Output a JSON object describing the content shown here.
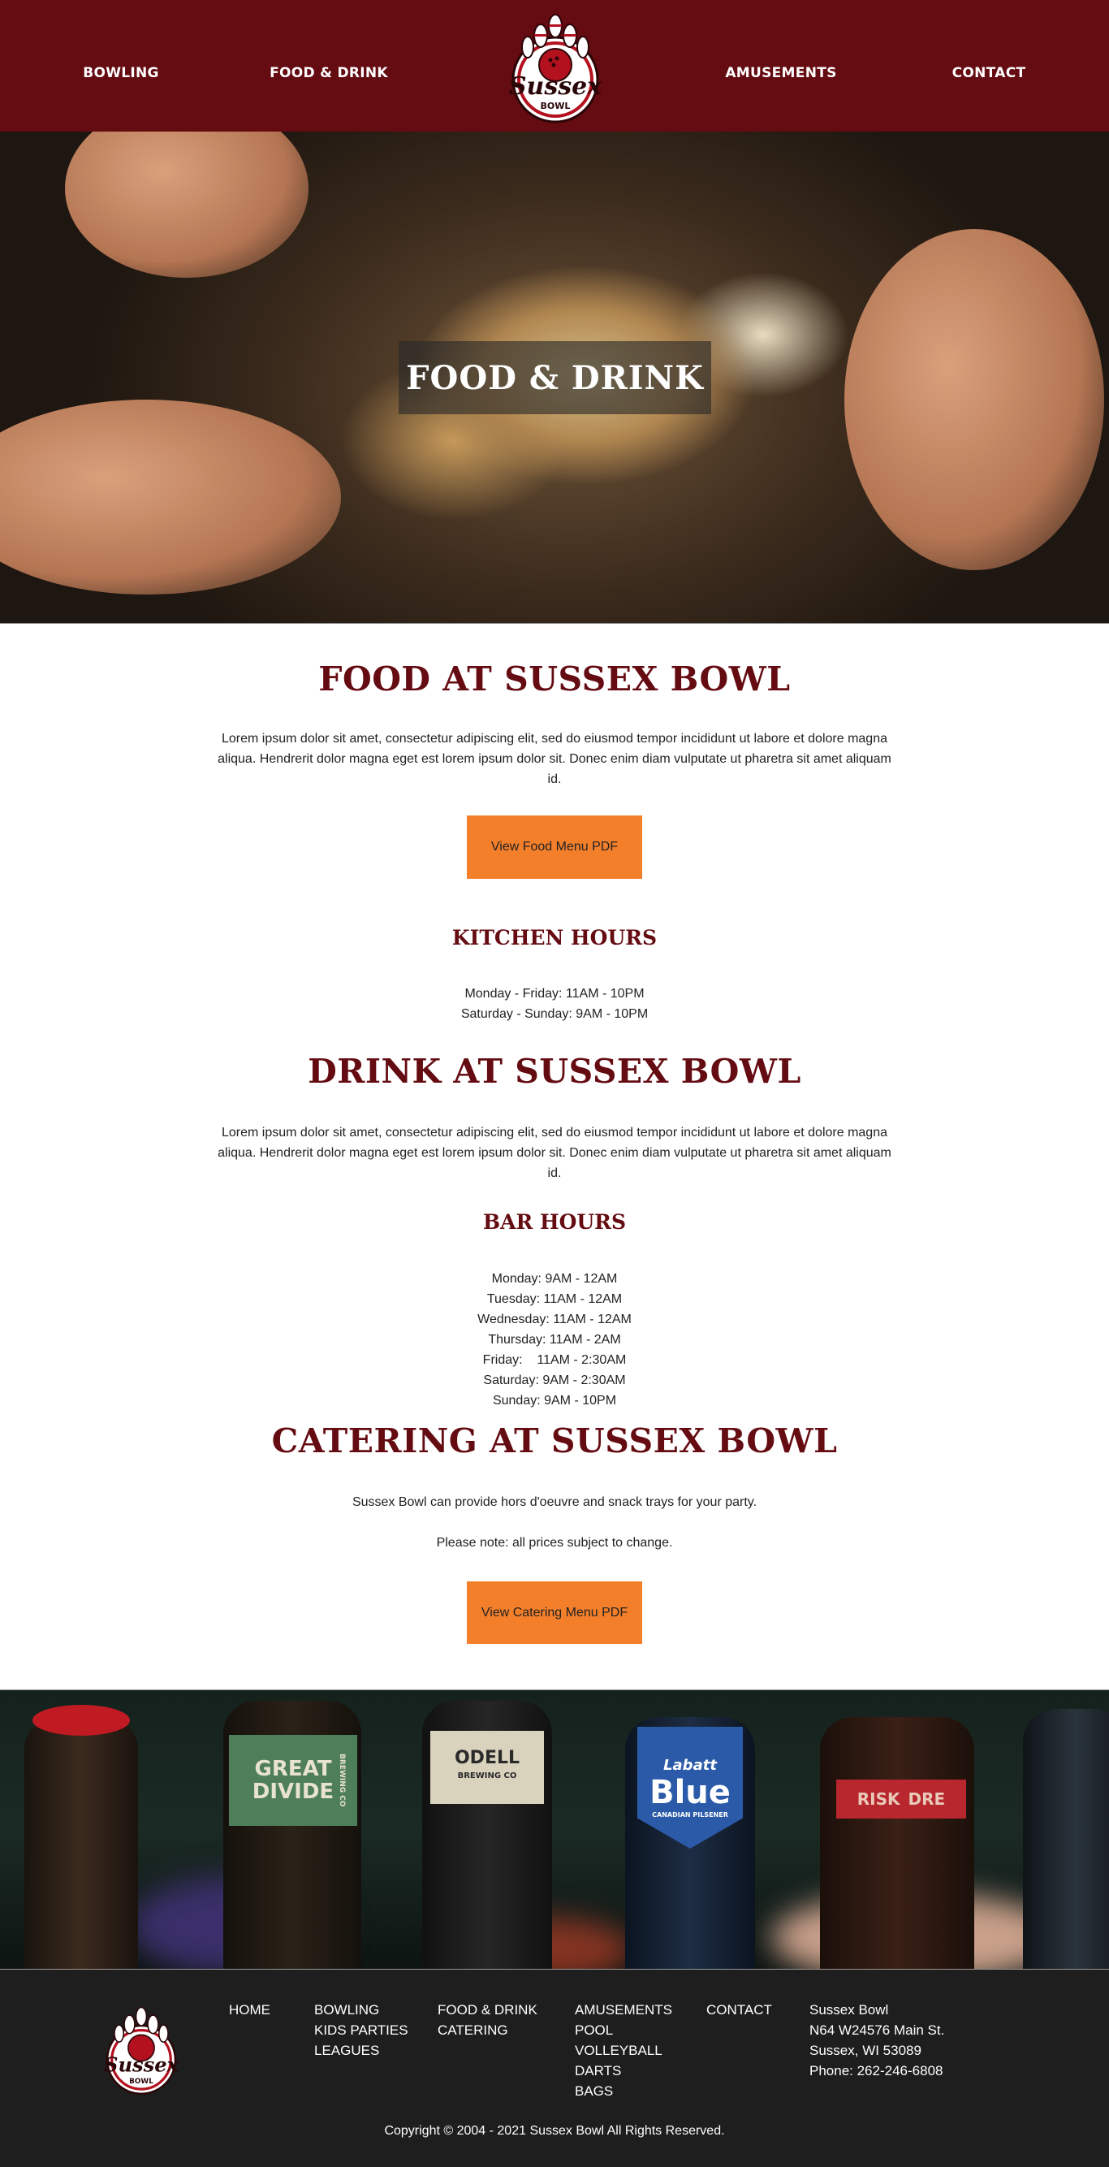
{
  "header": {
    "nav_left": [
      "BOWLING",
      "FOOD & DRINK"
    ],
    "nav_right": [
      "AMUSEMENTS",
      "CONTACT"
    ],
    "logo_text": "Sussex",
    "logo_subtext": "BOWL"
  },
  "hero": {
    "title": "FOOD & DRINK"
  },
  "food": {
    "heading": "FOOD AT SUSSEX BOWL",
    "body_line1": "Lorem ipsum dolor sit amet, consectetur adipiscing elit, sed do eiusmod tempor incididunt ut labore et dolore magna",
    "body_line2": "aliqua. Hendrerit dolor magna eget est lorem ipsum dolor sit. Donec enim diam vulputate ut pharetra sit amet aliquam",
    "body_line3": "id.",
    "button_label": "View Food Menu PDF"
  },
  "kitchen": {
    "heading": "KITCHEN HOURS",
    "hours": [
      "Monday - Friday: 11AM - 10PM",
      "Saturday - Sunday: 9AM - 10PM"
    ]
  },
  "drink": {
    "heading": "DRINK AT SUSSEX BOWL",
    "body_line1": "Lorem ipsum dolor sit amet, consectetur adipiscing elit, sed do eiusmod tempor incididunt ut labore et dolore magna",
    "body_line2": "aliqua. Hendrerit dolor magna eget est lorem ipsum dolor sit. Donec enim diam vulputate ut pharetra sit amet aliquam",
    "body_line3": "id."
  },
  "bar": {
    "heading": "BAR HOURS",
    "hours": [
      "Monday: 9AM - 12AM",
      "Tuesday: 11AM - 12AM",
      "Wednesday: 11AM - 12AM",
      "Thursday: 11AM - 2AM",
      "Friday:    11AM - 2:30AM",
      "Saturday: 9AM - 2:30AM",
      "Sunday: 9AM - 10PM"
    ]
  },
  "catering": {
    "heading": "CATERING AT SUSSEX BOWL",
    "line1": "Sussex Bowl can provide hors d'oeuvre and snack trays for your party.",
    "line2": "Please note: all prices subject to change.",
    "button_label": "View Catering Menu PDF"
  },
  "beer_labels": [
    "GREAT DIVIDE",
    "BREWING CO",
    "ODELL",
    "BREWING CO",
    "Labatt",
    "Blue",
    "CANADIAN PILSENER",
    "RISK",
    "DRE"
  ],
  "footer": {
    "col_home": [
      "HOME"
    ],
    "col_bowling": [
      "BOWLING",
      "KIDS PARTIES",
      "LEAGUES"
    ],
    "col_food": [
      "FOOD & DRINK",
      "CATERING"
    ],
    "col_amusements": [
      "AMUSEMENTS",
      "POOL",
      "VOLLEYBALL",
      "DARTS",
      "BAGS"
    ],
    "col_contact": [
      "CONTACT"
    ],
    "address": [
      "Sussex Bowl",
      "N64 W24576 Main St.",
      "Sussex, WI 53089",
      "Phone: 262-246-6808"
    ],
    "copyright": "Copyright © 2004 - 2021 Sussex Bowl All Rights Reserved."
  },
  "colors": {
    "brand": "#650b12",
    "accent": "#f47f2b",
    "footer_bg": "#1e1e1e"
  },
  "icons": {
    "logo": "bowling-pins-logo-icon"
  }
}
